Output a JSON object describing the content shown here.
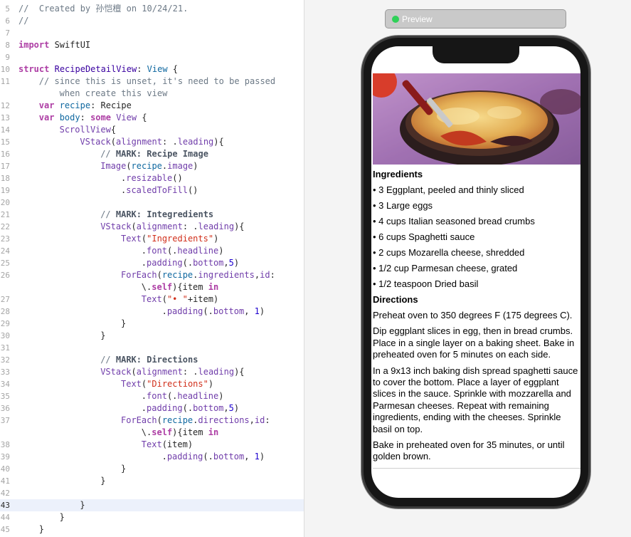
{
  "editor": {
    "lines": [
      {
        "num": "5",
        "indent": 0,
        "tokens": [
          {
            "t": "//  Created by 孙恺檀 on 10/24/21.",
            "c": "c-cmt"
          }
        ]
      },
      {
        "num": "6",
        "indent": 0,
        "tokens": [
          {
            "t": "//",
            "c": "c-cmt"
          }
        ]
      },
      {
        "num": "7",
        "indent": 0,
        "tokens": []
      },
      {
        "num": "8",
        "indent": 0,
        "tokens": [
          {
            "t": "import",
            "c": "c-kw"
          },
          {
            "t": " SwiftUI",
            "c": ""
          }
        ]
      },
      {
        "num": "9",
        "indent": 0,
        "tokens": []
      },
      {
        "num": "10",
        "indent": 0,
        "tokens": [
          {
            "t": "struct",
            "c": "c-kw"
          },
          {
            "t": " ",
            "c": ""
          },
          {
            "t": "RecipeDetailView",
            "c": "c-ty"
          },
          {
            "t": ": ",
            "c": ""
          },
          {
            "t": "View",
            "c": "c-tp"
          },
          {
            "t": " {",
            "c": ""
          }
        ]
      },
      {
        "num": "11",
        "indent": 4,
        "tokens": [
          {
            "t": "// since this is unset, it's need to be passed",
            "c": "c-cmt"
          }
        ]
      },
      {
        "num": "",
        "indent": 8,
        "tokens": [
          {
            "t": "when create this view",
            "c": "c-cmt"
          }
        ]
      },
      {
        "num": "12",
        "indent": 4,
        "tokens": [
          {
            "t": "var",
            "c": "c-kw"
          },
          {
            "t": " recipe",
            "c": "c-tp"
          },
          {
            "t": ": Recipe",
            "c": ""
          }
        ]
      },
      {
        "num": "13",
        "indent": 4,
        "tokens": [
          {
            "t": "var",
            "c": "c-kw"
          },
          {
            "t": " body",
            "c": "c-tp"
          },
          {
            "t": ": ",
            "c": ""
          },
          {
            "t": "some",
            "c": "c-kw"
          },
          {
            "t": " ",
            "c": ""
          },
          {
            "t": "View",
            "c": "c-pr"
          },
          {
            "t": " {",
            "c": ""
          }
        ]
      },
      {
        "num": "14",
        "indent": 8,
        "tokens": [
          {
            "t": "ScrollView",
            "c": "c-pr"
          },
          {
            "t": "{",
            "c": ""
          }
        ]
      },
      {
        "num": "15",
        "indent": 12,
        "tokens": [
          {
            "t": "VStack",
            "c": "c-pr"
          },
          {
            "t": "(",
            "c": ""
          },
          {
            "t": "alignment",
            "c": "c-pr"
          },
          {
            "t": ": .",
            "c": ""
          },
          {
            "t": "leading",
            "c": "c-pr"
          },
          {
            "t": "){",
            "c": ""
          }
        ]
      },
      {
        "num": "16",
        "indent": 16,
        "tokens": [
          {
            "t": "// ",
            "c": "c-cmt"
          },
          {
            "t": "MARK: Recipe Image",
            "c": "c-mark"
          }
        ]
      },
      {
        "num": "17",
        "indent": 16,
        "tokens": [
          {
            "t": "Image",
            "c": "c-pr"
          },
          {
            "t": "(",
            "c": ""
          },
          {
            "t": "recipe",
            "c": "c-tp"
          },
          {
            "t": ".",
            "c": ""
          },
          {
            "t": "image",
            "c": "c-pr"
          },
          {
            "t": ")",
            "c": ""
          }
        ]
      },
      {
        "num": "18",
        "indent": 20,
        "tokens": [
          {
            "t": ".",
            "c": ""
          },
          {
            "t": "resizable",
            "c": "c-pr"
          },
          {
            "t": "()",
            "c": ""
          }
        ]
      },
      {
        "num": "19",
        "indent": 20,
        "tokens": [
          {
            "t": ".",
            "c": ""
          },
          {
            "t": "scaledToFill",
            "c": "c-pr"
          },
          {
            "t": "()",
            "c": ""
          }
        ]
      },
      {
        "num": "20",
        "indent": 0,
        "tokens": []
      },
      {
        "num": "21",
        "indent": 16,
        "tokens": [
          {
            "t": "// ",
            "c": "c-cmt"
          },
          {
            "t": "MARK: Integredients",
            "c": "c-mark"
          }
        ]
      },
      {
        "num": "22",
        "indent": 16,
        "tokens": [
          {
            "t": "VStack",
            "c": "c-pr"
          },
          {
            "t": "(",
            "c": ""
          },
          {
            "t": "alignment",
            "c": "c-pr"
          },
          {
            "t": ": .",
            "c": ""
          },
          {
            "t": "leading",
            "c": "c-pr"
          },
          {
            "t": "){",
            "c": ""
          }
        ]
      },
      {
        "num": "23",
        "indent": 20,
        "tokens": [
          {
            "t": "Text",
            "c": "c-pr"
          },
          {
            "t": "(",
            "c": ""
          },
          {
            "t": "\"Ingredients\"",
            "c": "c-str"
          },
          {
            "t": ")",
            "c": ""
          }
        ]
      },
      {
        "num": "24",
        "indent": 24,
        "tokens": [
          {
            "t": ".",
            "c": ""
          },
          {
            "t": "font",
            "c": "c-pr"
          },
          {
            "t": "(.",
            "c": ""
          },
          {
            "t": "headline",
            "c": "c-pr"
          },
          {
            "t": ")",
            "c": ""
          }
        ]
      },
      {
        "num": "25",
        "indent": 24,
        "tokens": [
          {
            "t": ".",
            "c": ""
          },
          {
            "t": "padding",
            "c": "c-pr"
          },
          {
            "t": "(.",
            "c": ""
          },
          {
            "t": "bottom",
            "c": "c-pr"
          },
          {
            "t": ",",
            "c": ""
          },
          {
            "t": "5",
            "c": "c-num"
          },
          {
            "t": ")",
            "c": ""
          }
        ]
      },
      {
        "num": "26",
        "indent": 20,
        "tokens": [
          {
            "t": "ForEach",
            "c": "c-pr"
          },
          {
            "t": "(",
            "c": ""
          },
          {
            "t": "recipe",
            "c": "c-tp"
          },
          {
            "t": ".",
            "c": ""
          },
          {
            "t": "ingredients",
            "c": "c-pr"
          },
          {
            "t": ",",
            "c": ""
          },
          {
            "t": "id",
            "c": "c-pr"
          },
          {
            "t": ":",
            "c": ""
          }
        ]
      },
      {
        "num": "",
        "indent": 24,
        "tokens": [
          {
            "t": "\\.",
            "c": ""
          },
          {
            "t": "self",
            "c": "c-kw"
          },
          {
            "t": "){item ",
            "c": ""
          },
          {
            "t": "in",
            "c": "c-kw"
          }
        ]
      },
      {
        "num": "27",
        "indent": 24,
        "tokens": [
          {
            "t": "Text",
            "c": "c-pr"
          },
          {
            "t": "(",
            "c": ""
          },
          {
            "t": "\"• \"",
            "c": "c-str"
          },
          {
            "t": "+item)",
            "c": ""
          }
        ]
      },
      {
        "num": "28",
        "indent": 28,
        "tokens": [
          {
            "t": ".",
            "c": ""
          },
          {
            "t": "padding",
            "c": "c-pr"
          },
          {
            "t": "(.",
            "c": ""
          },
          {
            "t": "bottom",
            "c": "c-pr"
          },
          {
            "t": ", ",
            "c": ""
          },
          {
            "t": "1",
            "c": "c-num"
          },
          {
            "t": ")",
            "c": ""
          }
        ]
      },
      {
        "num": "29",
        "indent": 20,
        "tokens": [
          {
            "t": "}",
            "c": ""
          }
        ]
      },
      {
        "num": "30",
        "indent": 16,
        "tokens": [
          {
            "t": "}",
            "c": ""
          }
        ]
      },
      {
        "num": "31",
        "indent": 0,
        "tokens": []
      },
      {
        "num": "32",
        "indent": 16,
        "tokens": [
          {
            "t": "// ",
            "c": "c-cmt"
          },
          {
            "t": "MARK: Directions",
            "c": "c-mark"
          }
        ]
      },
      {
        "num": "33",
        "indent": 16,
        "tokens": [
          {
            "t": "VStack",
            "c": "c-pr"
          },
          {
            "t": "(",
            "c": ""
          },
          {
            "t": "alignment",
            "c": "c-pr"
          },
          {
            "t": ": .",
            "c": ""
          },
          {
            "t": "leading",
            "c": "c-pr"
          },
          {
            "t": "){",
            "c": ""
          }
        ]
      },
      {
        "num": "34",
        "indent": 20,
        "tokens": [
          {
            "t": "Text",
            "c": "c-pr"
          },
          {
            "t": "(",
            "c": ""
          },
          {
            "t": "\"Directions\"",
            "c": "c-str"
          },
          {
            "t": ")",
            "c": ""
          }
        ]
      },
      {
        "num": "35",
        "indent": 24,
        "tokens": [
          {
            "t": ".",
            "c": ""
          },
          {
            "t": "font",
            "c": "c-pr"
          },
          {
            "t": "(.",
            "c": ""
          },
          {
            "t": "headline",
            "c": "c-pr"
          },
          {
            "t": ")",
            "c": ""
          }
        ]
      },
      {
        "num": "36",
        "indent": 24,
        "tokens": [
          {
            "t": ".",
            "c": ""
          },
          {
            "t": "padding",
            "c": "c-pr"
          },
          {
            "t": "(.",
            "c": ""
          },
          {
            "t": "bottom",
            "c": "c-pr"
          },
          {
            "t": ",",
            "c": ""
          },
          {
            "t": "5",
            "c": "c-num"
          },
          {
            "t": ")",
            "c": ""
          }
        ]
      },
      {
        "num": "37",
        "indent": 20,
        "tokens": [
          {
            "t": "ForEach",
            "c": "c-pr"
          },
          {
            "t": "(",
            "c": ""
          },
          {
            "t": "recipe",
            "c": "c-tp"
          },
          {
            "t": ".",
            "c": ""
          },
          {
            "t": "directions",
            "c": "c-pr"
          },
          {
            "t": ",",
            "c": ""
          },
          {
            "t": "id",
            "c": "c-pr"
          },
          {
            "t": ":",
            "c": ""
          }
        ]
      },
      {
        "num": "",
        "indent": 24,
        "tokens": [
          {
            "t": "\\.",
            "c": ""
          },
          {
            "t": "self",
            "c": "c-kw"
          },
          {
            "t": "){item ",
            "c": ""
          },
          {
            "t": "in",
            "c": "c-kw"
          }
        ]
      },
      {
        "num": "38",
        "indent": 24,
        "tokens": [
          {
            "t": "Text",
            "c": "c-pr"
          },
          {
            "t": "(item)",
            "c": ""
          }
        ]
      },
      {
        "num": "39",
        "indent": 28,
        "tokens": [
          {
            "t": ".",
            "c": ""
          },
          {
            "t": "padding",
            "c": "c-pr"
          },
          {
            "t": "(.",
            "c": ""
          },
          {
            "t": "bottom",
            "c": "c-pr"
          },
          {
            "t": ", ",
            "c": ""
          },
          {
            "t": "1",
            "c": "c-num"
          },
          {
            "t": ")",
            "c": ""
          }
        ]
      },
      {
        "num": "40",
        "indent": 20,
        "tokens": [
          {
            "t": "}",
            "c": ""
          }
        ]
      },
      {
        "num": "41",
        "indent": 16,
        "tokens": [
          {
            "t": "}",
            "c": ""
          }
        ]
      },
      {
        "num": "42",
        "indent": 0,
        "tokens": []
      },
      {
        "num": "43",
        "indent": 12,
        "current": true,
        "tokens": [
          {
            "t": "}",
            "c": ""
          }
        ]
      },
      {
        "num": "44",
        "indent": 8,
        "tokens": [
          {
            "t": "}",
            "c": ""
          }
        ]
      },
      {
        "num": "45",
        "indent": 4,
        "tokens": [
          {
            "t": "}",
            "c": ""
          }
        ]
      }
    ]
  },
  "preview": {
    "badge_label": "Preview",
    "status_color": "#2fd158"
  },
  "recipe": {
    "ingredients_title": "Ingredients",
    "ingredients": [
      "• 3 Eggplant, peeled and thinly sliced",
      "• 3 Large eggs",
      "• 4 cups Italian seasoned bread crumbs",
      "• 6 cups Spaghetti sauce",
      "• 2 cups Mozarella cheese, shredded",
      "• 1/2 cup Parmesan cheese, grated",
      "• 1/2 teaspoon Dried basil"
    ],
    "directions_title": "Directions",
    "directions": [
      "Preheat oven to 350 degrees F (175 degrees C).",
      "Dip eggplant slices in egg, then in bread crumbs. Place in a single layer on a baking sheet. Bake in preheated oven for 5 minutes on each side.",
      "In a 9x13 inch baking dish spread spaghetti sauce to cover the bottom. Place a layer of eggplant slices in the sauce. Sprinkle with mozzarella and Parmesan cheeses. Repeat with remaining ingredients, ending with the cheeses. Sprinkle basil on top.",
      "Bake in preheated oven for 35 minutes, or until golden brown."
    ]
  }
}
